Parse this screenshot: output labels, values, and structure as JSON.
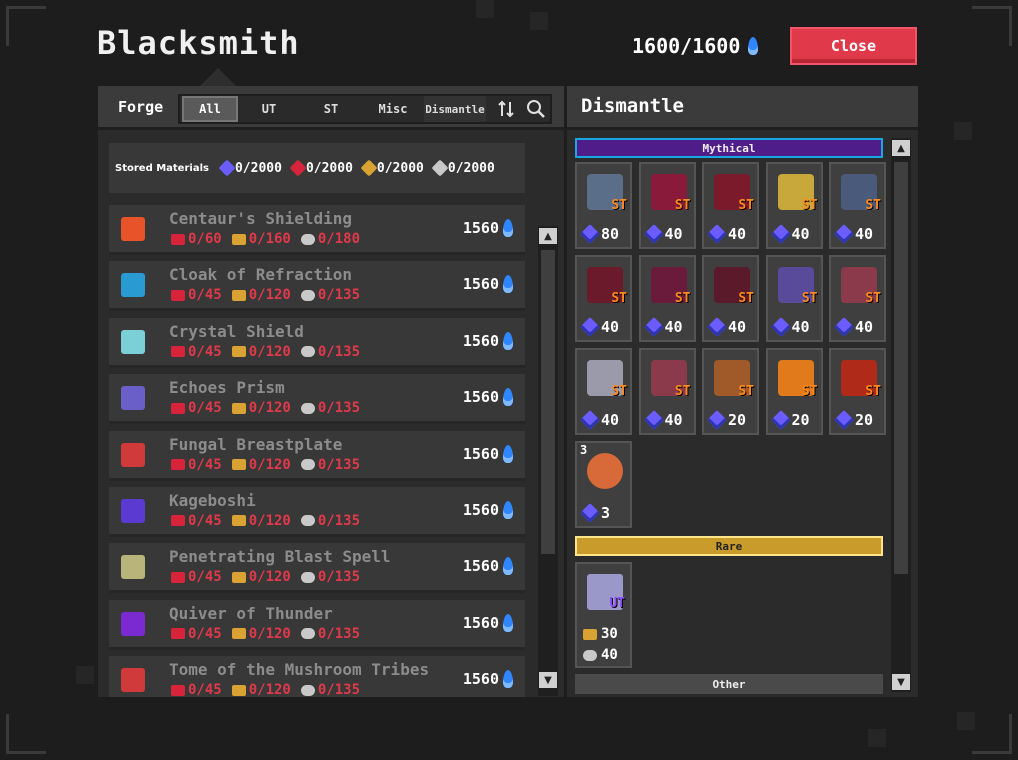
{
  "header": {
    "title": "Blacksmith",
    "fame": "1600/1600",
    "close_label": "Close"
  },
  "forge": {
    "label": "Forge",
    "tabs": [
      "All",
      "UT",
      "ST",
      "Misc",
      "Dismantle"
    ],
    "active_tab": "All"
  },
  "materials": {
    "label": "Stored Materials",
    "items": [
      {
        "icon": "blue-crystal-icon",
        "value": "0/2000",
        "color": "#6b5cff"
      },
      {
        "icon": "red-gem-icon",
        "value": "0/2000",
        "color": "#d8243a"
      },
      {
        "icon": "gold-ore-icon",
        "value": "0/2000",
        "color": "#d9a232"
      },
      {
        "icon": "silver-ore-icon",
        "value": "0/2000",
        "color": "#c9c9c9"
      }
    ]
  },
  "recipes": [
    {
      "name": "Centaur's Shielding",
      "r1": "0/60",
      "r2": "0/160",
      "r3": "0/180",
      "cost": "1560",
      "color": "#e8532a"
    },
    {
      "name": "Cloak of Refraction",
      "r1": "0/45",
      "r2": "0/120",
      "r3": "0/135",
      "cost": "1560",
      "color": "#2a9ad2"
    },
    {
      "name": "Crystal Shield",
      "r1": "0/45",
      "r2": "0/120",
      "r3": "0/135",
      "cost": "1560",
      "color": "#7ad0d6"
    },
    {
      "name": "Echoes Prism",
      "r1": "0/45",
      "r2": "0/120",
      "r3": "0/135",
      "cost": "1560",
      "color": "#6a5ec8"
    },
    {
      "name": "Fungal Breastplate",
      "r1": "0/45",
      "r2": "0/120",
      "r3": "0/135",
      "cost": "1560",
      "color": "#d03a3a"
    },
    {
      "name": "Kageboshi",
      "r1": "0/45",
      "r2": "0/120",
      "r3": "0/135",
      "cost": "1560",
      "color": "#5a3ad0"
    },
    {
      "name": "Penetrating Blast Spell",
      "r1": "0/45",
      "r2": "0/120",
      "r3": "0/135",
      "cost": "1560",
      "color": "#b8b47a"
    },
    {
      "name": "Quiver of Thunder",
      "r1": "0/45",
      "r2": "0/120",
      "r3": "0/135",
      "cost": "1560",
      "color": "#7a2ad0"
    },
    {
      "name": "Tome of the Mushroom Tribes",
      "r1": "0/45",
      "r2": "0/120",
      "r3": "0/135",
      "cost": "1560",
      "color": "#d03a3a"
    }
  ],
  "dismantle": {
    "title": "Dismantle",
    "mythical_label": "Mythical",
    "rare_label": "Rare",
    "other_label": "Other",
    "mythical_items": [
      {
        "yield": "80",
        "tag": "ST",
        "color": "#5a6e8a"
      },
      {
        "yield": "40",
        "tag": "ST",
        "color": "#8a1a3a"
      },
      {
        "yield": "40",
        "tag": "ST",
        "color": "#7a1a2a"
      },
      {
        "yield": "40",
        "tag": "ST",
        "color": "#c8a83a"
      },
      {
        "yield": "40",
        "tag": "ST",
        "color": "#4a5a7a"
      },
      {
        "yield": "40",
        "tag": "ST",
        "color": "#6a1a2a"
      },
      {
        "yield": "40",
        "tag": "ST",
        "color": "#6a1a3a"
      },
      {
        "yield": "40",
        "tag": "ST",
        "color": "#5a1a2a"
      },
      {
        "yield": "40",
        "tag": "ST",
        "color": "#5a4a9a"
      },
      {
        "yield": "40",
        "tag": "ST",
        "color": "#8a3a4a"
      },
      {
        "yield": "40",
        "tag": "ST",
        "color": "#9a9aaa"
      },
      {
        "yield": "40",
        "tag": "ST",
        "color": "#8a3a4a"
      },
      {
        "yield": "20",
        "tag": "ST",
        "color": "#a05a2a"
      },
      {
        "yield": "20",
        "tag": "ST",
        "color": "#e07a1a"
      },
      {
        "yield": "20",
        "tag": "ST",
        "color": "#b02a1a"
      },
      {
        "yield": "3",
        "tag": "",
        "qty": "3",
        "color": "#d86a3a"
      }
    ],
    "rare_item": {
      "tag": "UT",
      "gold": "30",
      "silver": "40"
    }
  }
}
